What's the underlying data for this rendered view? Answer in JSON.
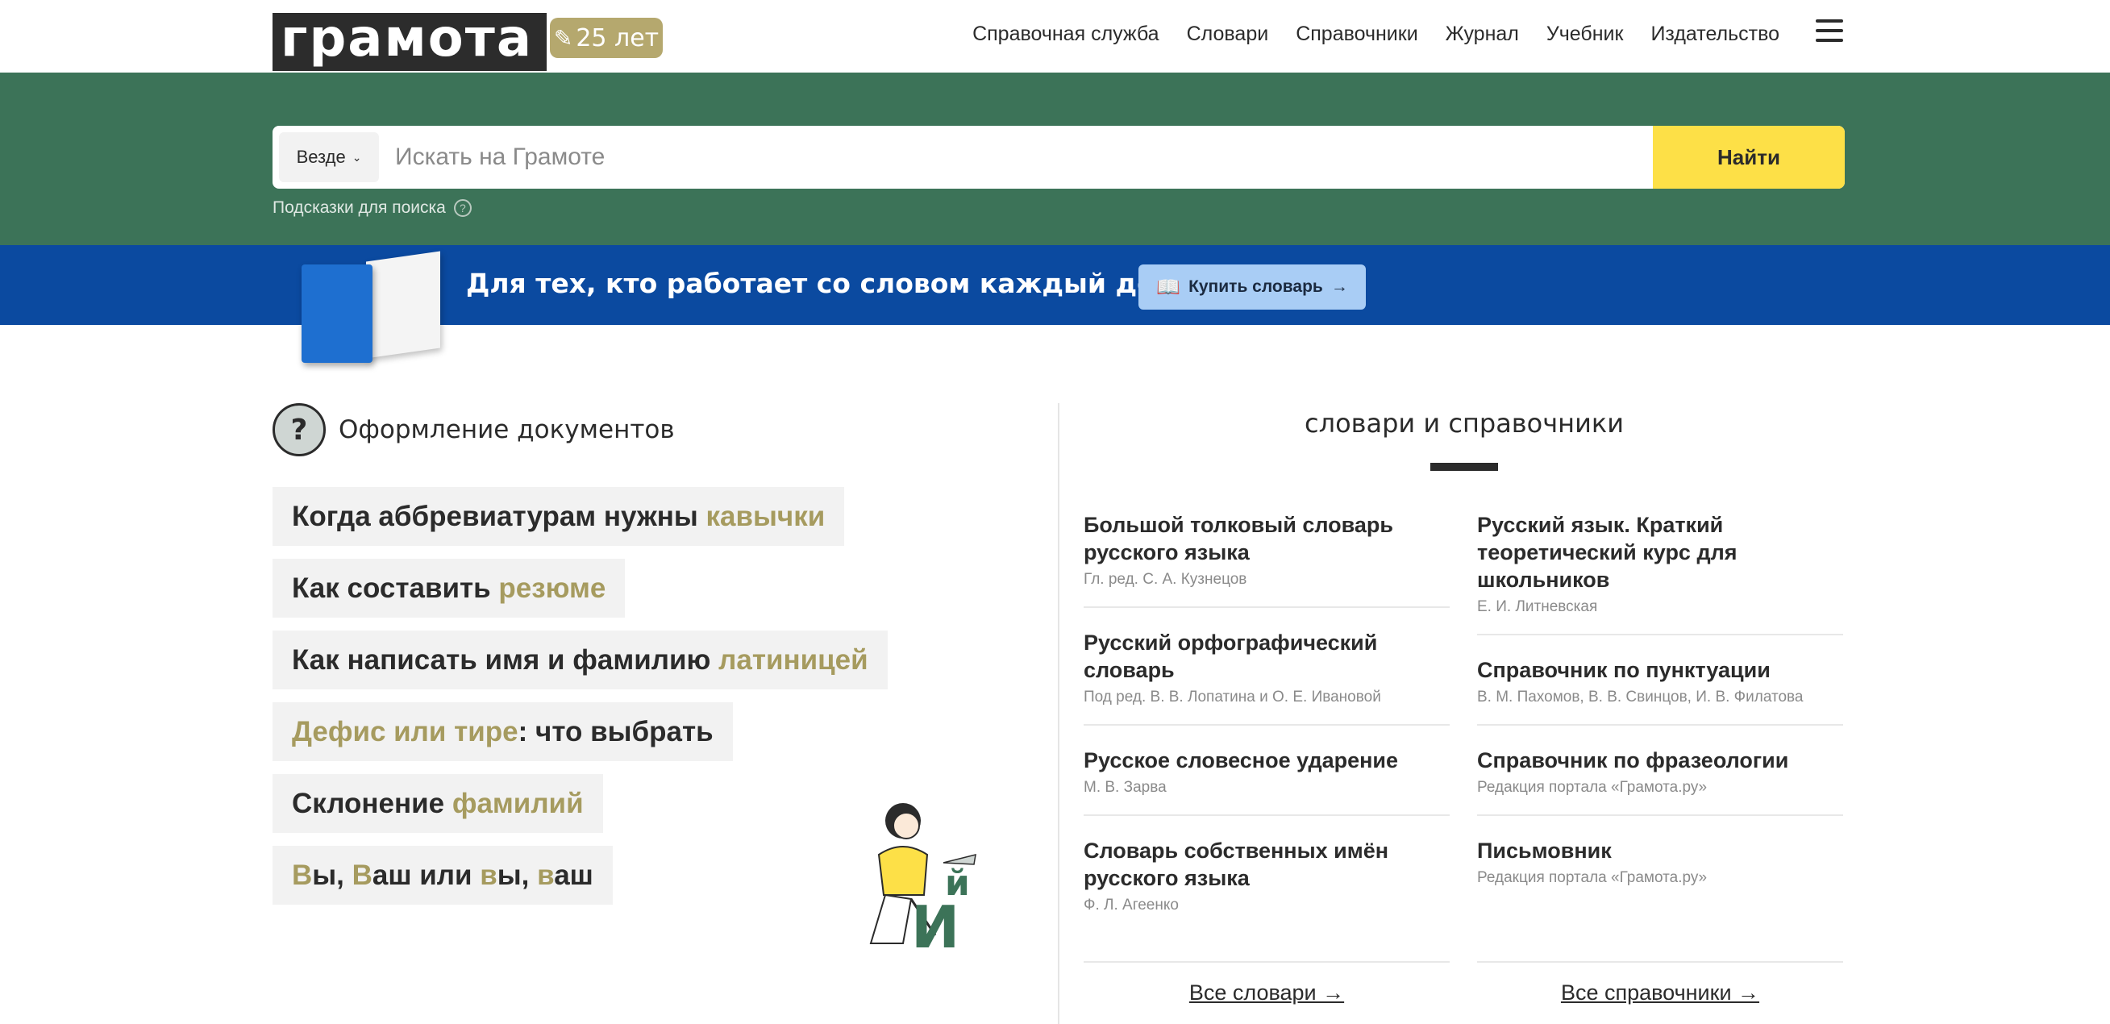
{
  "header": {
    "logo_text": "грамота",
    "anniversary": "25 лет",
    "nav": [
      "Справочная служба",
      "Словари",
      "Справочники",
      "Журнал",
      "Учебник",
      "Издательство"
    ]
  },
  "search": {
    "scope": "Везде",
    "placeholder": "Искать на Грамоте",
    "button": "Найти",
    "hints": "Подсказки для поиска"
  },
  "promo": {
    "text": "Для тех, кто работает со словом каждый день",
    "button": "Купить словарь"
  },
  "docs": {
    "title": "Оформление документов",
    "topics": [
      [
        {
          "t": "Когда аббревиатурам нужны "
        },
        {
          "t": "кавычки",
          "hl": true
        }
      ],
      [
        {
          "t": "Как составить "
        },
        {
          "t": "резюме",
          "hl": true
        }
      ],
      [
        {
          "t": "Как написать имя и фамилию "
        },
        {
          "t": "латиницей",
          "hl": true
        }
      ],
      [
        {
          "t": "Дефис или тире",
          "hl": true
        },
        {
          "t": ": что выбрать"
        }
      ],
      [
        {
          "t": "Склонение "
        },
        {
          "t": "фамилий",
          "hl": true
        }
      ],
      [
        {
          "t": "В",
          "hl": true
        },
        {
          "t": "ы, "
        },
        {
          "t": "В",
          "hl": true
        },
        {
          "t": "аш или "
        },
        {
          "t": "в",
          "hl": true
        },
        {
          "t": "ы, "
        },
        {
          "t": "в",
          "hl": true
        },
        {
          "t": "аш"
        }
      ]
    ]
  },
  "dictionaries": {
    "title": "словари и справочники",
    "left": [
      {
        "name": "Большой толковый словарь русского языка",
        "author": "Гл. ред. С. А. Кузнецов"
      },
      {
        "name": "Русский орфографический словарь",
        "author": "Под ред. В. В. Лопатина и О. Е. Ивановой"
      },
      {
        "name": "Русское словесное ударение",
        "author": "М. В. Зарва"
      },
      {
        "name": "Словарь собственных имён русского языка",
        "author": "Ф. Л. Агеенко"
      }
    ],
    "right": [
      {
        "name": "Русский язык. Краткий теоретический курс для школьников",
        "author": "Е. И. Литневская"
      },
      {
        "name": "Справочник по пунктуации",
        "author": "В. М. Пахомов, В. В. Свинцов, И. В. Филатова"
      },
      {
        "name": "Справочник по фразеологии",
        "author": "Редакция портала «Грамота.ру»"
      },
      {
        "name": "Письмовник",
        "author": "Редакция портала «Грамота.ру»"
      }
    ],
    "all_dicts": "Все словари →",
    "all_refs": "Все справочники →"
  },
  "colors": {
    "search_band": "#3c7358",
    "promo": "#0b4aa0",
    "search_button": "#fde047",
    "highlight": "#a69b5f"
  }
}
